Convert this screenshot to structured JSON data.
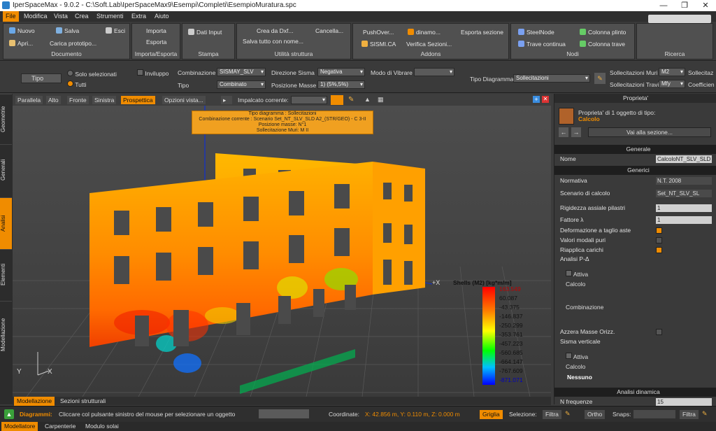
{
  "window": {
    "title": "IperSpaceMax - 9.0.2 - C:\\Soft.Lab\\IperSpaceMax9\\Esempi\\Completi\\EsempioMuratura.spc",
    "minimize": "—",
    "restore": "❐",
    "close": "✕"
  },
  "menu": [
    "File",
    "Modifica",
    "Vista",
    "Crea",
    "Strumenti",
    "Extra",
    "Aiuto"
  ],
  "ribbon": {
    "documento": {
      "label": "Documento",
      "nuovo": "Nuovo",
      "salva": "Salva",
      "esci": "Esci",
      "apri": "Apri...",
      "carica": "Carica prototipo..."
    },
    "importa": {
      "label": "Importa/Esporta",
      "importa": "Importa",
      "esporta": "Esporta"
    },
    "stampa": {
      "label": "Stampa",
      "dati": "Dati Input"
    },
    "utilita": {
      "label": "Utilità struttura",
      "crea_dxf": "Crea da Dxf...",
      "cancella": "Cancella...",
      "salva_nome": "Salva tutto con nome..."
    },
    "addons": {
      "label": "Addons",
      "pushover": "PushOver...",
      "dinamo": "dinamo...",
      "esporta_sezione": "Esporta sezione",
      "sismica": "SISMI.CA",
      "verifica": "Verifica Sezioni..."
    },
    "nodi": {
      "label": "Nodi",
      "steelnode": "SteelNode",
      "colonna_plinto": "Colonna plinto",
      "trave_continua": "Trave continua",
      "colonna_trave": "Colonna trave"
    },
    "ricerca": {
      "label": "Ricerca"
    }
  },
  "toolbar2": {
    "tipo": "Tipo",
    "solo_selezionati": "Solo selezionati",
    "tutti": "Tutti",
    "inviluppo": "Inviluppo",
    "combinazione_label": "Combinazione",
    "combinazione_value": "SISMAY_SLV",
    "tipo_label": "Tipo",
    "tipo_value": "Combinato",
    "direzione_label": "Direzione Sisma",
    "direzione_value": "Negativa",
    "posizione_label": "Posizione Masse",
    "posizione_value": "1) (5%,5%)",
    "modo_label": "Modo di Vibrare",
    "tipo_diagramma_label": "Tipo Diagramma",
    "tipo_diagramma_value": "Sollecitazioni",
    "soll_muri_label": "Sollecitazioni Muri",
    "soll_muri_value": "M2",
    "soll_travi_label": "Sollecitazioni Travi",
    "soll_travi_value": "Mfy",
    "soll_extra": "Sollecitaz",
    "coeff_extra": "Coefficien"
  },
  "left_tabs": [
    "Geometrie",
    "Generali",
    "Analisi",
    "Elementi",
    "Modellazione"
  ],
  "view_tabs": [
    "Parallela",
    "Alto",
    "Fronte",
    "Sinistra",
    "Prospettica",
    "Opzioni vista..."
  ],
  "impalcato_label": "Impalcato corrente:",
  "tooltip": {
    "line1": "Tipo diagramma : Sollecitazioni",
    "line2": "Combinazione corrente : Scenario Set_NT_SLV_SLD A2_(STR/GEO) - C 3-II",
    "line3": "Posizione masse: N°1",
    "line4": "Sollecitazione Muri: M II"
  },
  "axis": {
    "px": "+X",
    "y": "Y",
    "x": "X"
  },
  "legend": {
    "title": "Shells (M2) [kg*m/m]",
    "values": [
      "163.549",
      "60.087",
      "-43.375",
      "-146.837",
      "-250.299",
      "-353.761",
      "-457.223",
      "-560.685",
      "-664.147",
      "-767.609",
      "-871.071"
    ]
  },
  "bottom_tabs": [
    "Modellazione",
    "Sezioni strutturali"
  ],
  "panel": {
    "title": "Proprieta'",
    "header_text": "Proprieta' di 1 oggetto di tipo:",
    "header_type": "Calcolo",
    "goto": "Vai alla sezione...",
    "generale": "Generale",
    "nome_label": "Nome",
    "nome_value": "CalcoloNT_SLV_SLD",
    "generici": "Generici",
    "normativa_label": "Normativa",
    "normativa_value": "N.T. 2008",
    "scenario_label": "Scenario di calcolo",
    "scenario_value": "Set_NT_SLV_SL",
    "rigidezza_label": "Rigidezza assiale pilastri",
    "rigidezza_value": "1",
    "fattore_label": "Fattore λ",
    "fattore_value": "1",
    "deformazione_label": "Deformazione a taglio aste",
    "valori_label": "Valori modali puri",
    "riapplica_label": "Riapplica carichi",
    "pdelta_label": "Analisi P-Δ",
    "attiva1": "Attiva",
    "calcolo1": "Calcolo",
    "combinazione": "Combinazione",
    "azzera_label": "Azzera Masse Orizz.",
    "sisma_label": "Sisma verticale",
    "attiva2": "Attiva",
    "calcolo2": "Calcolo",
    "nessuno": "Nessuno",
    "dinamica": "Analisi dinamica",
    "nfreq_label": "N frequenze",
    "nfreq_value": "15"
  },
  "status": {
    "message_bold": "Diagrammi:",
    "message": "Cliccare col pulsante sinistro del mouse per selezionare un oggetto",
    "coord_label": "Coordinate:",
    "coord_value": "X: 42.856 m, Y: 0.110 m, Z: 0.000 m",
    "griglia": "Griglia",
    "selezione": "Selezione:",
    "filtra1": "Filtra",
    "ortho": "Ortho",
    "snaps": "Snaps:",
    "filtra2": "Filtra"
  },
  "footer": [
    "Modellatore",
    "Carpenterie",
    "Modulo solai"
  ],
  "colors": {
    "accent": "#f08c00",
    "legend_top": "#ff0000",
    "legend_bottom": "#0000ff"
  }
}
